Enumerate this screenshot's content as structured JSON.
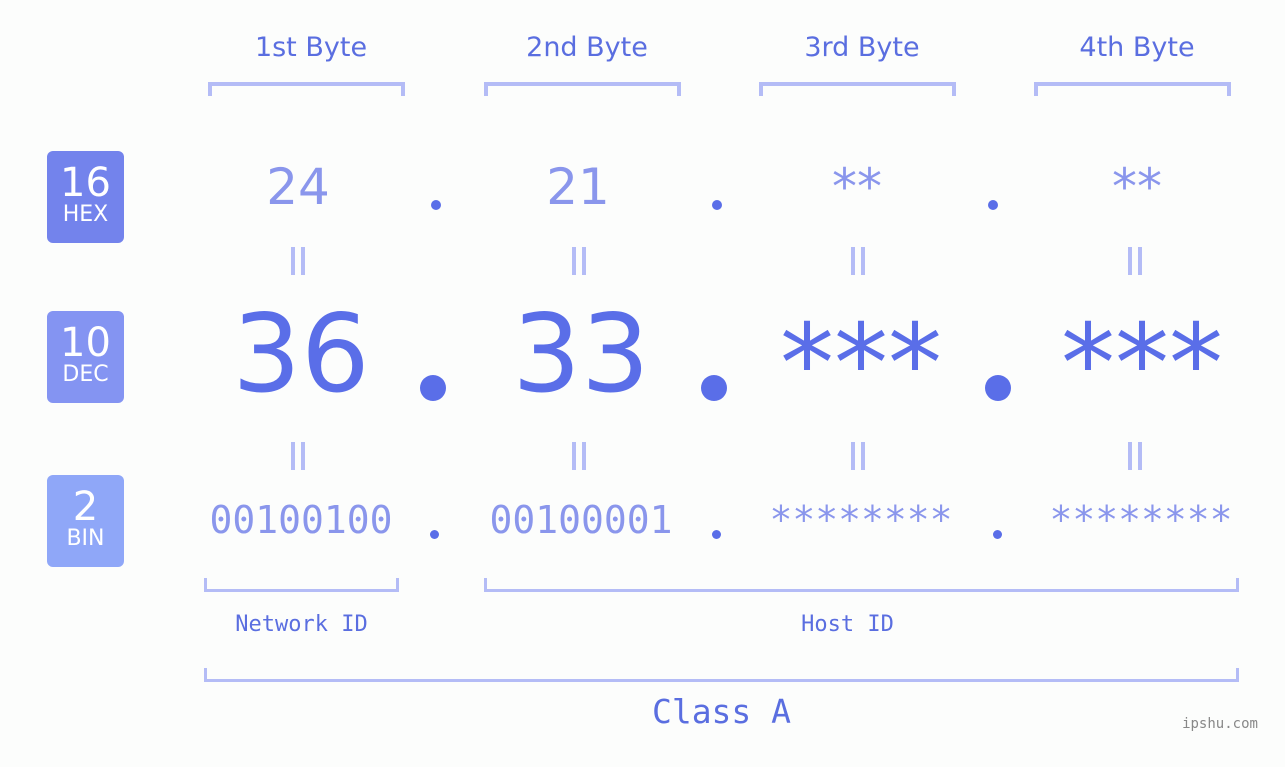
{
  "bytes": [
    {
      "label": "1st Byte",
      "hex": "24",
      "dec": "36",
      "bin": "00100100"
    },
    {
      "label": "2nd Byte",
      "hex": "21",
      "dec": "33",
      "bin": "00100001"
    },
    {
      "label": "3rd Byte",
      "hex": "**",
      "dec": "***",
      "bin": "********"
    },
    {
      "label": "4th Byte",
      "hex": "**",
      "dec": "***",
      "bin": "********"
    }
  ],
  "badges": {
    "hex": {
      "num": "16",
      "label": "HEX",
      "color": "#7383ec"
    },
    "dec": {
      "num": "10",
      "label": "DEC",
      "color": "#8494f2"
    },
    "bin": {
      "num": "2",
      "label": "BIN",
      "color": "#8fa7f8"
    }
  },
  "network_id_label": "Network ID",
  "host_id_label": "Host ID",
  "class_label": "Class A",
  "watermark": "ipshu.com",
  "colors": {
    "accent": "#5a6ee8",
    "light": "#8a96ec",
    "bracket": "#b4bcf6"
  }
}
